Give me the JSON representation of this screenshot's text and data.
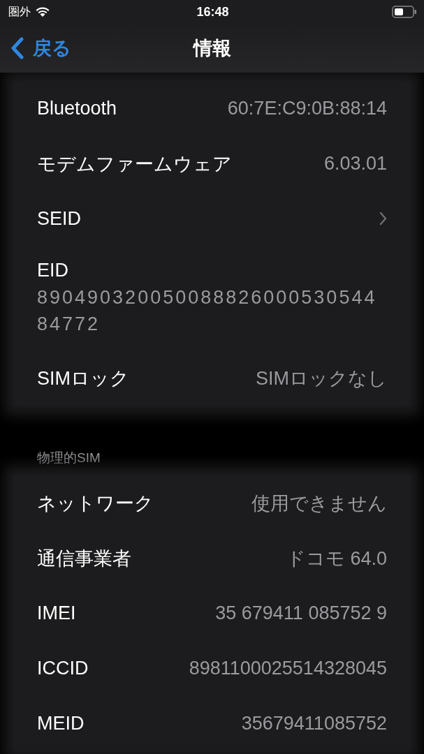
{
  "status_bar": {
    "carrier": "圏外",
    "time": "16:48"
  },
  "nav": {
    "back": "戻る",
    "title": "情報"
  },
  "sections": [
    {
      "rows": [
        {
          "kind": "value",
          "label": "Bluetooth",
          "value": "60:7E:C9:0B:88:14"
        },
        {
          "kind": "value",
          "label": "モデムファームウェア",
          "value": "6.03.01"
        },
        {
          "kind": "link",
          "label": "SEID"
        },
        {
          "kind": "stacked",
          "label": "EID",
          "value": "89049032005008882600053054484772"
        },
        {
          "kind": "value",
          "label": "SIMロック",
          "value": "SIMロックなし"
        }
      ]
    },
    {
      "header": "物理的SIM",
      "rows": [
        {
          "kind": "value",
          "label": "ネットワーク",
          "value": "使用できません"
        },
        {
          "kind": "value",
          "label": "通信事業者",
          "value": "ドコモ 64.0"
        },
        {
          "kind": "value",
          "label": "IMEI",
          "value": "35 679411 085752 9"
        },
        {
          "kind": "value",
          "label": "ICCID",
          "value": "8981100025514328045"
        },
        {
          "kind": "value",
          "label": "MEID",
          "value": "35679411085752"
        }
      ]
    }
  ]
}
